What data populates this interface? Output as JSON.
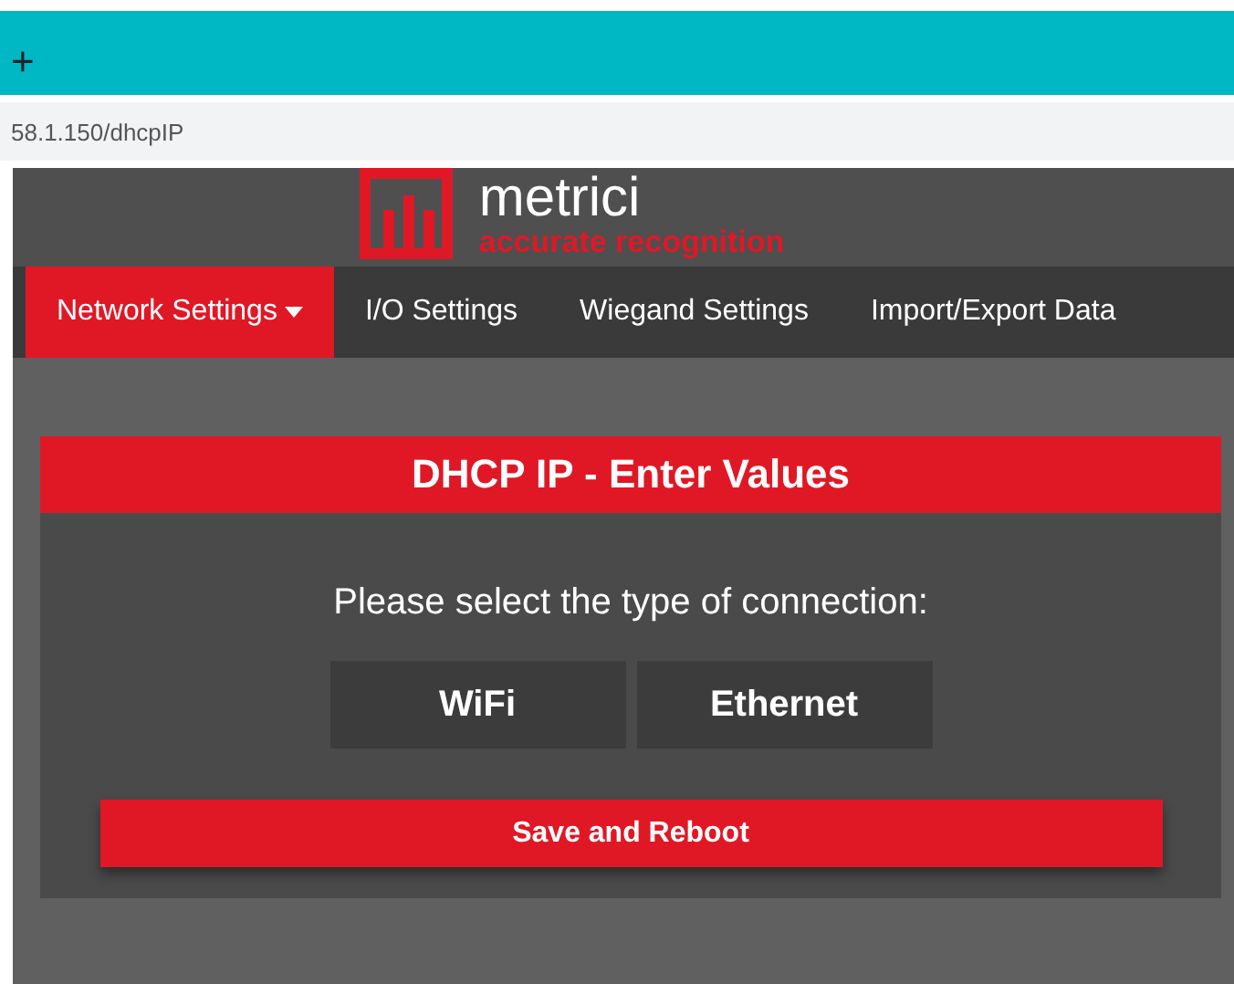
{
  "browser": {
    "new_tab": "+",
    "address": "58.1.150/dhcpIP"
  },
  "brand": {
    "name": "metrici",
    "tagline": "accurate recognition"
  },
  "nav": [
    {
      "label": "Network Settings",
      "selected": true,
      "dropdown": true
    },
    {
      "label": "I/O Settings",
      "selected": false,
      "dropdown": false
    },
    {
      "label": "Wiegand Settings",
      "selected": false,
      "dropdown": false
    },
    {
      "label": "Import/Export Data",
      "selected": false,
      "dropdown": false
    }
  ],
  "card": {
    "title": "DHCP IP - Enter Values",
    "prompt": "Please select the type of connection:",
    "options": [
      {
        "label": "WiFi",
        "selected": false
      },
      {
        "label": "Ethernet",
        "selected": false
      }
    ],
    "submit": "Save and Reboot"
  }
}
